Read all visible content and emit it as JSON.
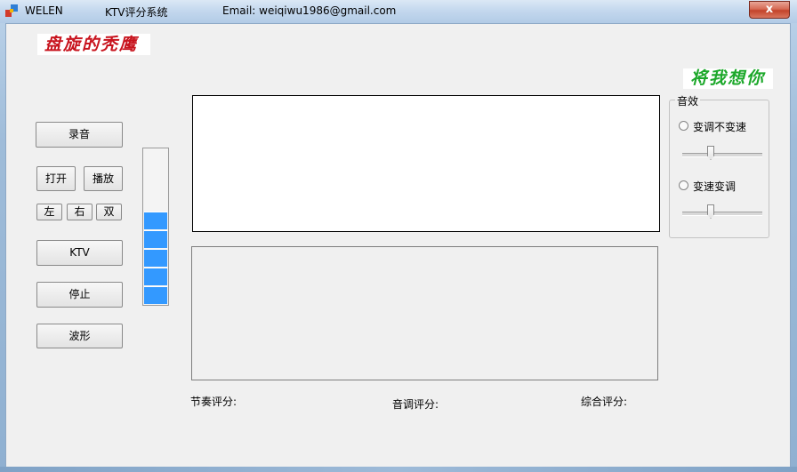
{
  "window": {
    "title_app": "WELEN",
    "title_name": "KTV评分系统",
    "title_email": "Email: weiqiwu1986@gmail.com",
    "close_label": "x"
  },
  "banners": {
    "left": "盘旋的秃鹰",
    "right": "将我想你",
    "left_color": "#c8141e",
    "right_color": "#1ca82a"
  },
  "buttons": {
    "record": "录音",
    "open": "打开",
    "play": "播放",
    "left": "左",
    "right": "右",
    "both": "双",
    "ktv": "KTV",
    "stop": "停止",
    "waveform": "波形"
  },
  "level_meter": {
    "level": 0.58,
    "color": "#3399ff"
  },
  "effects": {
    "group_label": "音效",
    "option1": "变调不变速",
    "option2": "变速变调"
  },
  "scores": {
    "rhythm_label": "节奏评分:",
    "pitch_label": "音调评分:",
    "overall_label": "综合评分:"
  }
}
